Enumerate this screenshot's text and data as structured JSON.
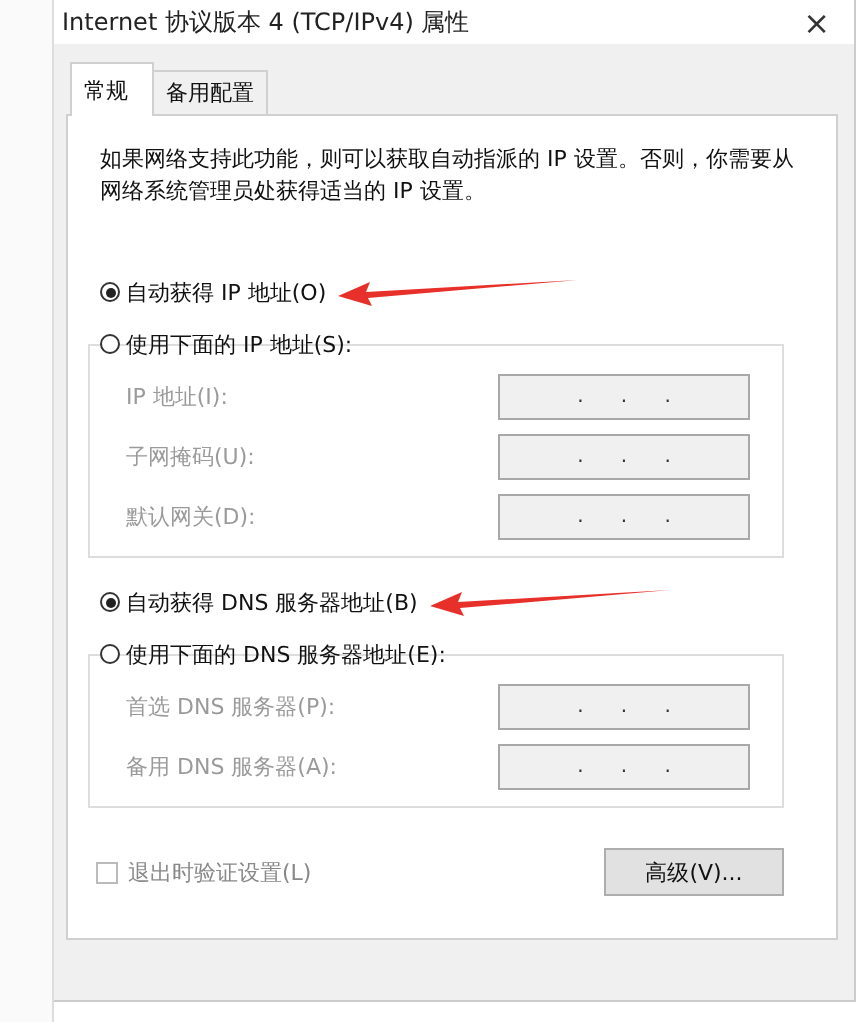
{
  "window": {
    "title": "Internet 协议版本 4 (TCP/IPv4) 属性",
    "close": "×"
  },
  "tabs": [
    {
      "label": "常规",
      "selected": true
    },
    {
      "label": "备用配置",
      "selected": false
    }
  ],
  "description": "如果网络支持此功能，则可以获取自动指派的 IP 设置。否则，你需要从网络系统管理员处获得适当的 IP 设置。",
  "ip_section": {
    "auto_option": {
      "label": "自动获得 IP 地址(O)",
      "selected": true,
      "arrow": true
    },
    "manual_option": {
      "label": "使用下面的 IP 地址(S):",
      "selected": false,
      "arrow": false
    },
    "fields": [
      {
        "label": "IP 地址(I):",
        "disabled": true,
        "separators": [
          ".",
          ".",
          "."
        ]
      },
      {
        "label": "子网掩码(U):",
        "disabled": true,
        "separators": [
          ".",
          ".",
          "."
        ]
      },
      {
        "label": "默认网关(D):",
        "disabled": true,
        "separators": [
          ".",
          ".",
          "."
        ]
      }
    ]
  },
  "dns_section": {
    "auto_option": {
      "label": "自动获得 DNS 服务器地址(B)",
      "selected": true,
      "arrow": true
    },
    "manual_option": {
      "label": "使用下面的 DNS 服务器地址(E):",
      "selected": false,
      "arrow": false
    },
    "fields": [
      {
        "label": "首选 DNS 服务器(P):",
        "disabled": true,
        "separators": [
          ".",
          ".",
          "."
        ]
      },
      {
        "label": "备用 DNS 服务器(A):",
        "disabled": true,
        "separators": [
          ".",
          ".",
          "."
        ]
      }
    ]
  },
  "validate_on_exit": {
    "label": "退出时验证设置(L)",
    "checked": false,
    "disabled": true
  },
  "advanced_button": {
    "label": "高级(V)..."
  }
}
